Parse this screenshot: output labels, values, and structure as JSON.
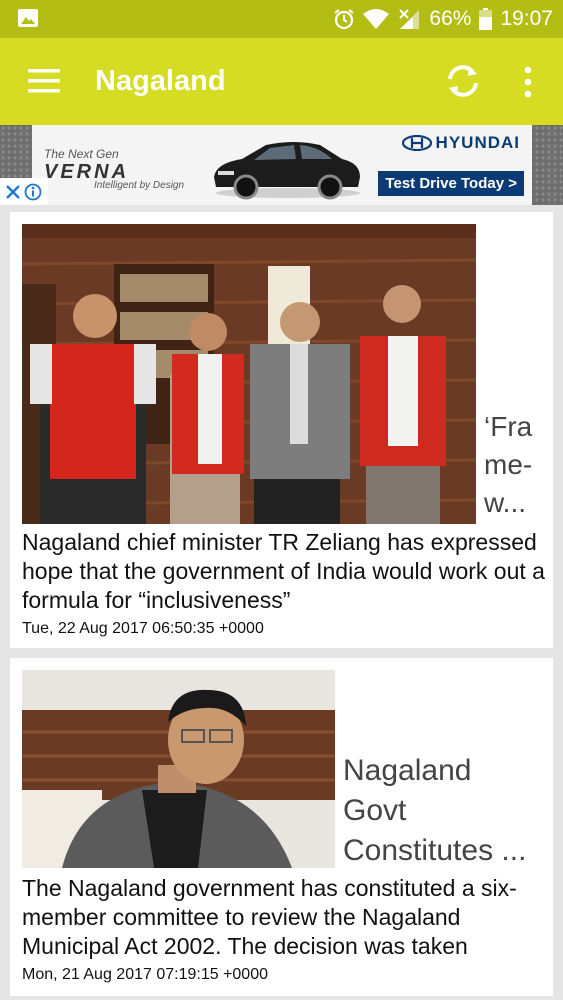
{
  "status_bar": {
    "battery": "66%",
    "time": "19:07",
    "icons": [
      "gallery-icon",
      "alarm-icon",
      "wifi-icon",
      "no-signal-icon",
      "battery-icon"
    ]
  },
  "app_bar": {
    "title": "Nagaland",
    "icons": [
      "menu-icon",
      "refresh-icon",
      "more-vert-icon"
    ],
    "color": "#d5dc22"
  },
  "ad": {
    "tagline": "The Next Gen",
    "model": "VERNA",
    "subline": "Intelligent by Design",
    "brand": "HYUNDAI",
    "cta": "Test Drive Today >"
  },
  "articles": [
    {
      "title": "‘Frame-w...",
      "title_lines": [
        "‘Fra",
        "me-",
        "w..."
      ],
      "description": "Nagaland chief minister TR Zeliang has expressed hope that the government of India would work out a formula for “inclusiveness”",
      "date": "Tue, 22 Aug 2017 06:50:35 +0000"
    },
    {
      "title": "Nagaland Govt Constitutes ...",
      "title_lines": [
        "Nagaland",
        "Govt",
        "Constitutes ..."
      ],
      "description": "The Nagaland government has constituted a six-member committee to review the Nagaland Municipal Act 2002. The decision was taken",
      "date": "Mon, 21 Aug 2017 07:19:15 +0000"
    }
  ]
}
